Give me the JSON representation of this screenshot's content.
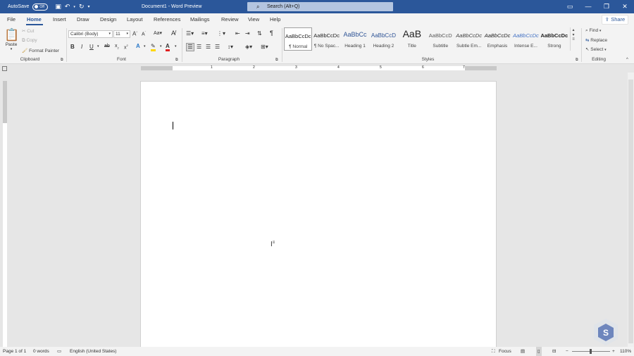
{
  "titlebar": {
    "autosave_label": "AutoSave",
    "autosave_state": "Off",
    "document_title": "Document1 - Word Preview",
    "search_placeholder": "Search (Alt+Q)"
  },
  "menu": {
    "tabs": [
      "File",
      "Home",
      "Insert",
      "Draw",
      "Design",
      "Layout",
      "References",
      "Mailings",
      "Review",
      "View",
      "Help"
    ],
    "active": "Home",
    "share_label": "Share"
  },
  "clipboard": {
    "paste": "Paste",
    "cut": "Cut",
    "copy": "Copy",
    "format_painter": "Format Painter",
    "group": "Clipboard"
  },
  "font": {
    "family": "Calibri (Body)",
    "size": "11",
    "group": "Font"
  },
  "paragraph": {
    "group": "Paragraph"
  },
  "styles": {
    "items": [
      {
        "preview": "AaBbCcDc",
        "name": "¶ Normal"
      },
      {
        "preview": "AaBbCcDc",
        "name": "¶ No Spac..."
      },
      {
        "preview": "AaBbCc",
        "name": "Heading 1"
      },
      {
        "preview": "AaBbCcD",
        "name": "Heading 2"
      },
      {
        "preview": "AaB",
        "name": "Title"
      },
      {
        "preview": "AaBbCcD",
        "name": "Subtitle"
      },
      {
        "preview": "AaBbCcDc",
        "name": "Subtle Em..."
      },
      {
        "preview": "AaBbCcDc",
        "name": "Emphasis"
      },
      {
        "preview": "AaBbCcDc",
        "name": "Intense E..."
      },
      {
        "preview": "AaBbCcDc",
        "name": "Strong"
      }
    ],
    "group": "Styles"
  },
  "editing": {
    "find": "Find",
    "replace": "Replace",
    "select": "Select",
    "group": "Editing"
  },
  "ruler": {
    "numbers": [
      "1",
      "2",
      "3",
      "4",
      "5",
      "6",
      "7"
    ]
  },
  "status": {
    "page": "Page 1 of 1",
    "words": "0 words",
    "language": "English (United States)",
    "focus": "Focus",
    "zoom": "110%"
  },
  "colors": {
    "accent": "#2b579a",
    "highlight": "#ffd700",
    "font_color": "#e02020"
  }
}
